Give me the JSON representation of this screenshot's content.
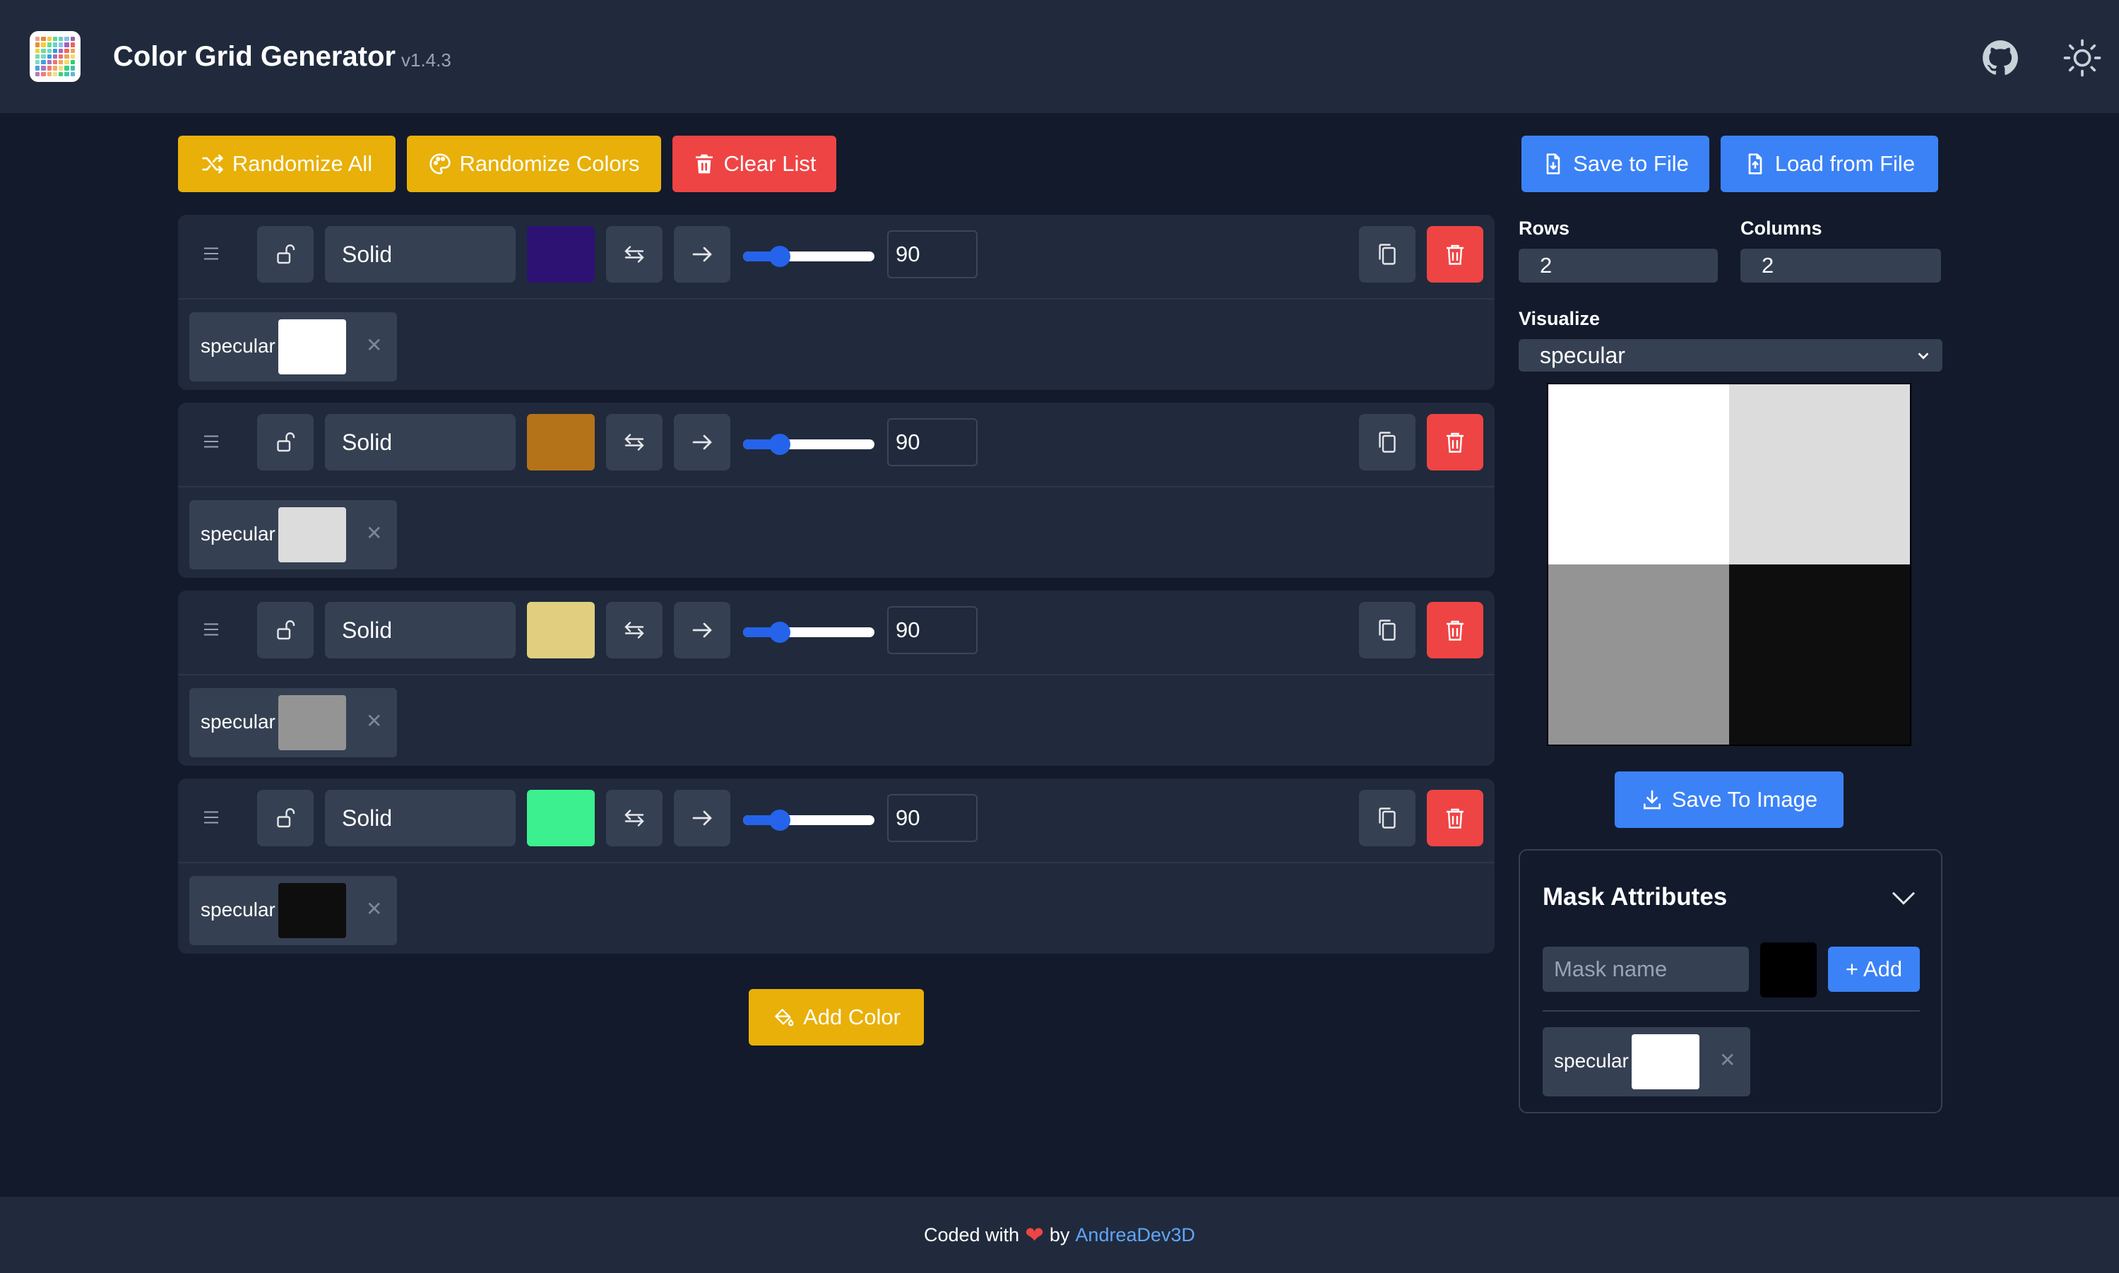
{
  "header": {
    "title": "Color Grid Generator",
    "version": "v1.4.3",
    "github_icon": "github-icon",
    "theme_icon": "sun-icon"
  },
  "toolbar": {
    "randomize_all": "Randomize All",
    "randomize_colors": "Randomize Colors",
    "clear_list": "Clear List",
    "save_to_file": "Save to File",
    "load_from_file": "Load from File"
  },
  "rows": [
    {
      "type": "Solid",
      "color": "#2d1274",
      "value": "90",
      "slider": 0.28,
      "mask_label": "specular",
      "mask_color": "#ffffff"
    },
    {
      "type": "Solid",
      "color": "#b57319",
      "value": "90",
      "slider": 0.28,
      "mask_label": "specular",
      "mask_color": "#dcdcdc"
    },
    {
      "type": "Solid",
      "color": "#e1cf7f",
      "value": "90",
      "slider": 0.28,
      "mask_label": "specular",
      "mask_color": "#949494"
    },
    {
      "type": "Solid",
      "color": "#3cf08f",
      "value": "90",
      "slider": 0.28,
      "mask_label": "specular",
      "mask_color": "#0e0e0e"
    }
  ],
  "add_color": "Add Color",
  "grid": {
    "rows_label": "Rows",
    "rows_value": "2",
    "columns_label": "Columns",
    "columns_value": "2",
    "visualize_label": "Visualize",
    "visualize_value": "specular",
    "preview_colors": [
      "#ffffff",
      "#dcdcdc",
      "#949494",
      "#0e0e0e"
    ],
    "save_image": "Save To Image"
  },
  "mask_panel": {
    "title": "Mask Attributes",
    "name_placeholder": "Mask name",
    "new_color": "#000000",
    "add_label": "+ Add",
    "items": [
      {
        "label": "specular",
        "color": "#ffffff"
      }
    ]
  },
  "footer": {
    "prefix": "Coded with",
    "by": "by",
    "author": "AndreaDev3D"
  }
}
